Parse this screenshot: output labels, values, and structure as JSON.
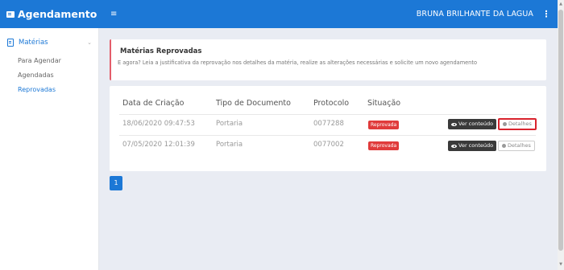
{
  "header": {
    "brand": "Agendamento",
    "menu_glyph": "≡",
    "user_name": "BRUNA BRILHANTE DA LAGUA",
    "user_menu_glyph": "⋮"
  },
  "sidebar": {
    "group_label": "Matérias",
    "chevron": "⌄",
    "items": [
      {
        "label": "Para Agendar"
      },
      {
        "label": "Agendadas"
      },
      {
        "label": "Reprovadas"
      }
    ]
  },
  "info": {
    "title": "Matérias Reprovadas",
    "text": "E agora? Leia a justificativa da reprovação nos detalhes da matéria, realize as alterações necessárias e solicite um novo agendamento"
  },
  "table": {
    "headers": [
      "Data de Criação",
      "Tipo de Documento",
      "Protocolo",
      "Situação"
    ],
    "rows": [
      {
        "date": "18/06/2020 09:47:53",
        "type": "Portaria",
        "protocol": "0077288",
        "status": "Reprovada",
        "view_label": "Ver conteúdo",
        "details_label": "Detalhes"
      },
      {
        "date": "07/05/2020 12:01:39",
        "type": "Portaria",
        "protocol": "0077002",
        "status": "Reprovada",
        "view_label": "Ver conteúdo",
        "details_label": "Detalhes"
      }
    ]
  },
  "pagination": {
    "current": "1"
  },
  "colors": {
    "primary": "#1c78d6",
    "danger": "#e03b3b",
    "highlight": "#d9232d"
  },
  "icons": {
    "brand": "calendar-icon",
    "menu": "hamburger-icon",
    "group": "document-icon",
    "view": "eye-icon",
    "details": "dot-icon"
  }
}
